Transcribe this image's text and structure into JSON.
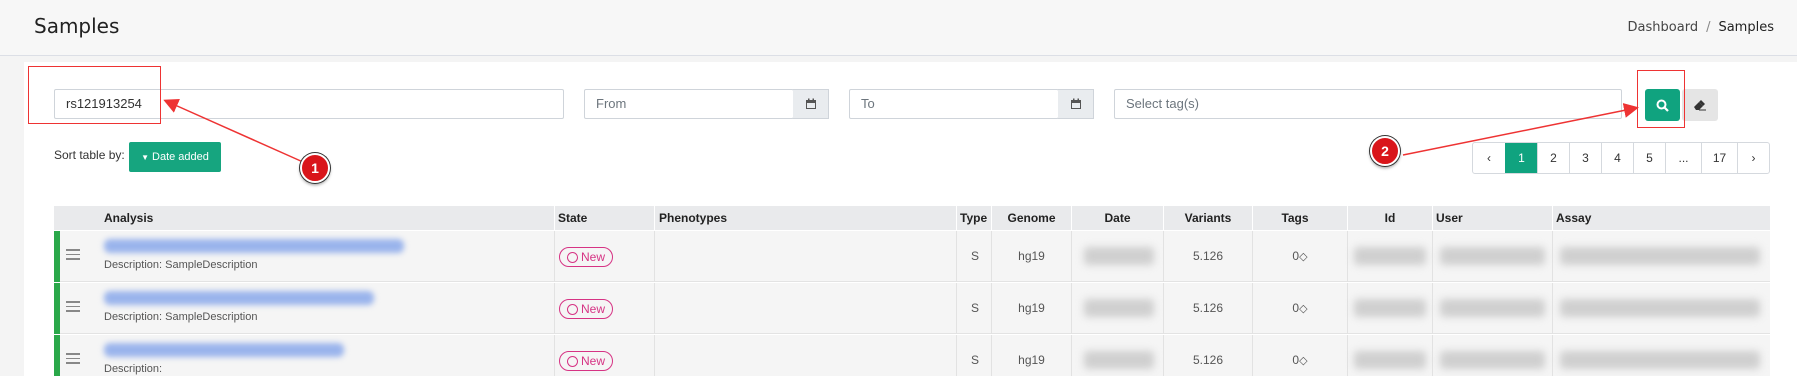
{
  "header": {
    "title": "Samples",
    "breadcrumb": [
      "Dashboard",
      "Samples"
    ]
  },
  "filters": {
    "search_value": "rs121913254",
    "from_placeholder": "From",
    "to_placeholder": "To",
    "tags_placeholder": "Select tag(s)"
  },
  "sort": {
    "label": "Sort table by:",
    "button": "Date added"
  },
  "pagination": [
    "1",
    "2",
    "3",
    "4",
    "5",
    "...",
    "17"
  ],
  "table": {
    "columns": [
      "Analysis",
      "State",
      "Phenotypes",
      "Type",
      "Genome",
      "Date",
      "Variants",
      "Tags",
      "Id",
      "User",
      "Assay"
    ],
    "rows": [
      {
        "description": "Description: SampleDescription",
        "state": "New",
        "type": "S",
        "genome": "hg19",
        "variants": "5.126",
        "tags": "0"
      },
      {
        "description": "Description: SampleDescription",
        "state": "New",
        "type": "S",
        "genome": "hg19",
        "variants": "5.126",
        "tags": "0"
      },
      {
        "description": "Description:",
        "state": "New",
        "type": "S",
        "genome": "hg19",
        "variants": "5.126",
        "tags": "0"
      }
    ]
  },
  "annotations": [
    "1",
    "2"
  ],
  "colors": {
    "accent": "#10a37f",
    "state": "#d63384",
    "annotation": "#d9151a"
  }
}
